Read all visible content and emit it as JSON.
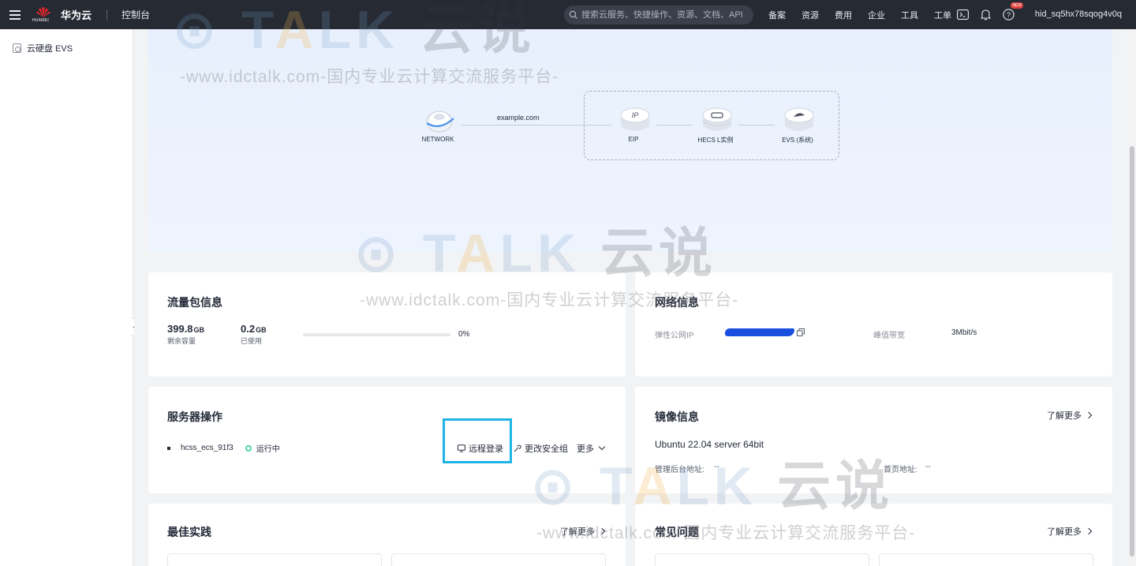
{
  "topbar": {
    "logo_sub": "HUAWEI",
    "brand": "华为云",
    "console": "控制台",
    "search_placeholder": "搜索云服务、快捷操作、资源、文档、API",
    "nav": [
      "备案",
      "资源",
      "费用",
      "企业",
      "工具",
      "工单"
    ],
    "new_badge": "NEW",
    "username": "hid_sq5hx78sqog4v0q"
  },
  "sidebar": {
    "item": "云硬盘 EVS"
  },
  "diagram": {
    "nodes": [
      "NETWORK",
      "EIP",
      "HECS L实例",
      "EVS (系统)"
    ],
    "domain": "example.com"
  },
  "traffic": {
    "title": "流量包信息",
    "remaining_value": "399.8",
    "remaining_unit": "GB",
    "remaining_label": "剩余容量",
    "used_value": "0.2",
    "used_unit": "GB",
    "used_label": "已使用",
    "percent": "0%",
    "percent_value": 0
  },
  "network": {
    "title": "网络信息",
    "eip_label": "弹性公网IP",
    "bandwidth_label": "峰值带宽",
    "bandwidth_value": "3Mbit/s"
  },
  "server_ops": {
    "title": "服务器操作",
    "server_name": "hcss_ecs_91f3",
    "status": "运行中",
    "remote_login": "远程登录",
    "change_sg": "更改安全组",
    "more": "更多"
  },
  "image_info": {
    "title": "镜像信息",
    "learn_more": "了解更多",
    "os": "Ubuntu 22.04 server 64bit",
    "admin_label": "管理后台地址:",
    "admin_value": "--",
    "home_label": "首页地址:",
    "home_value": "--"
  },
  "best_practice": {
    "title": "最佳实践",
    "learn_more": "了解更多"
  },
  "faq": {
    "title": "常见问题",
    "learn_more": "了解更多"
  },
  "watermark": {
    "brand": "TALK",
    "brand_a": "A",
    "brand_cn": "云说",
    "url": "-www.idctalk.com-国内专业云计算交流服务平台-"
  },
  "colors": {
    "topbar": "#252a33",
    "accent": "#5e7ce0",
    "running": "#50d4ab",
    "highlight": "#1fb4e6"
  }
}
